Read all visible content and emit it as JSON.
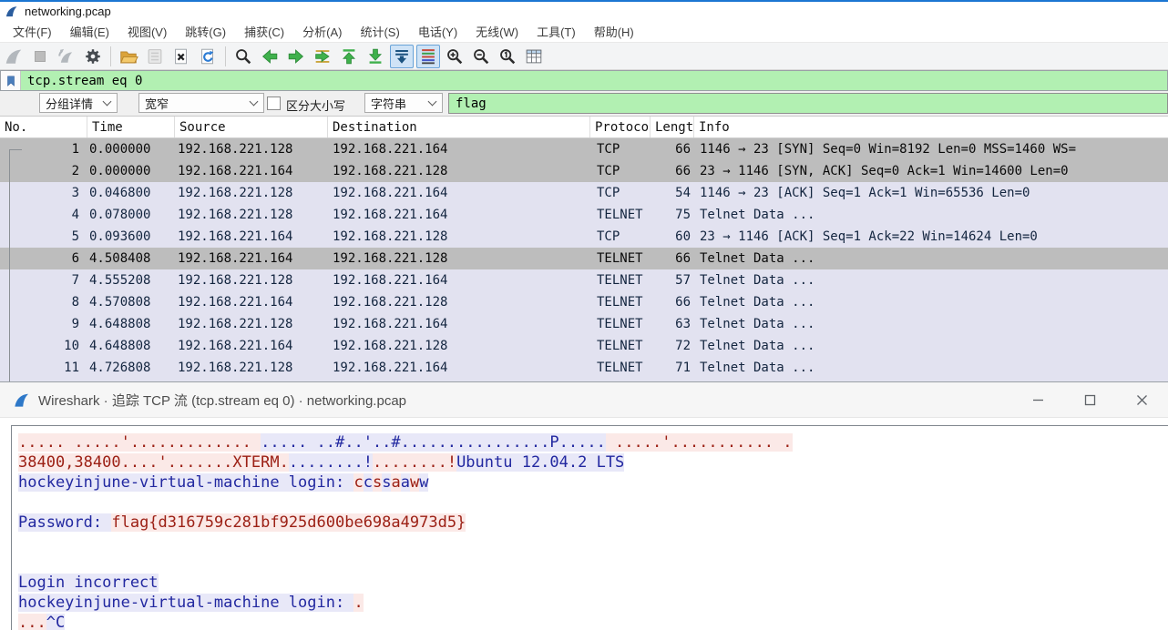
{
  "window": {
    "title": "networking.pcap",
    "menu": [
      "文件(F)",
      "编辑(E)",
      "视图(V)",
      "跳转(G)",
      "捕获(C)",
      "分析(A)",
      "统计(S)",
      "电话(Y)",
      "无线(W)",
      "工具(T)",
      "帮助(H)"
    ]
  },
  "toolbar": {
    "buttons": [
      {
        "name": "start-capture-icon",
        "state": "disabled"
      },
      {
        "name": "stop-capture-icon",
        "state": "disabled"
      },
      {
        "name": "restart-capture-icon",
        "state": "disabled"
      },
      {
        "name": "capture-options-icon",
        "state": "normal"
      },
      {
        "name": "separator"
      },
      {
        "name": "open-file-icon",
        "state": "normal"
      },
      {
        "name": "save-file-icon",
        "state": "disabled"
      },
      {
        "name": "close-file-icon",
        "state": "normal"
      },
      {
        "name": "reload-file-icon",
        "state": "normal"
      },
      {
        "name": "separator"
      },
      {
        "name": "find-packet-icon",
        "state": "normal"
      },
      {
        "name": "go-back-icon",
        "state": "normal"
      },
      {
        "name": "go-forward-icon",
        "state": "normal"
      },
      {
        "name": "go-to-packet-icon",
        "state": "normal"
      },
      {
        "name": "go-first-packet-icon",
        "state": "normal"
      },
      {
        "name": "go-last-packet-icon",
        "state": "normal"
      },
      {
        "name": "auto-scroll-icon",
        "state": "toggled"
      },
      {
        "name": "colorize-packets-icon",
        "state": "toggled"
      },
      {
        "name": "zoom-in-icon",
        "state": "normal"
      },
      {
        "name": "zoom-out-icon",
        "state": "normal"
      },
      {
        "name": "zoom-original-icon",
        "state": "normal"
      },
      {
        "name": "resize-columns-icon",
        "state": "normal"
      }
    ]
  },
  "filter_bar": {
    "value": "tcp.stream eq 0"
  },
  "find_bar": {
    "search_in_value": "分组详情",
    "char_width_value": "宽窄",
    "case_sensitive_label": "区分大小写",
    "case_sensitive_checked": false,
    "search_type_value": "字符串",
    "query_value": "flag"
  },
  "packet_list": {
    "columns": [
      "No.",
      "Time",
      "Source",
      "Destination",
      "Protocol",
      "Length",
      "Info"
    ],
    "rows": [
      {
        "no": "1",
        "time": "0.000000",
        "source": "192.168.221.128",
        "destination": "192.168.221.164",
        "protocol": "TCP",
        "length": "66",
        "info": "1146 → 23 [SYN] Seq=0 Win=8192 Len=0 MSS=1460 WS=",
        "selected": true
      },
      {
        "no": "2",
        "time": "0.000000",
        "source": "192.168.221.164",
        "destination": "192.168.221.128",
        "protocol": "TCP",
        "length": "66",
        "info": "23 → 1146 [SYN, ACK] Seq=0 Ack=1 Win=14600 Len=0",
        "selected": true
      },
      {
        "no": "3",
        "time": "0.046800",
        "source": "192.168.221.128",
        "destination": "192.168.221.164",
        "protocol": "TCP",
        "length": "54",
        "info": "1146 → 23 [ACK] Seq=1 Ack=1 Win=65536 Len=0",
        "selected": false
      },
      {
        "no": "4",
        "time": "0.078000",
        "source": "192.168.221.128",
        "destination": "192.168.221.164",
        "protocol": "TELNET",
        "length": "75",
        "info": "Telnet Data ...",
        "selected": false
      },
      {
        "no": "5",
        "time": "0.093600",
        "source": "192.168.221.164",
        "destination": "192.168.221.128",
        "protocol": "TCP",
        "length": "60",
        "info": "23 → 1146 [ACK] Seq=1 Ack=22 Win=14624 Len=0",
        "selected": false
      },
      {
        "no": "6",
        "time": "4.508408",
        "source": "192.168.221.164",
        "destination": "192.168.221.128",
        "protocol": "TELNET",
        "length": "66",
        "info": "Telnet Data ...",
        "selected": true
      },
      {
        "no": "7",
        "time": "4.555208",
        "source": "192.168.221.128",
        "destination": "192.168.221.164",
        "protocol": "TELNET",
        "length": "57",
        "info": "Telnet Data ...",
        "selected": false
      },
      {
        "no": "8",
        "time": "4.570808",
        "source": "192.168.221.164",
        "destination": "192.168.221.128",
        "protocol": "TELNET",
        "length": "66",
        "info": "Telnet Data ...",
        "selected": false
      },
      {
        "no": "9",
        "time": "4.648808",
        "source": "192.168.221.128",
        "destination": "192.168.221.164",
        "protocol": "TELNET",
        "length": "63",
        "info": "Telnet Data ...",
        "selected": false
      },
      {
        "no": "10",
        "time": "4.648808",
        "source": "192.168.221.164",
        "destination": "192.168.221.128",
        "protocol": "TELNET",
        "length": "72",
        "info": "Telnet Data ...",
        "selected": false
      },
      {
        "no": "11",
        "time": "4.726808",
        "source": "192.168.221.128",
        "destination": "192.168.221.164",
        "protocol": "TELNET",
        "length": "71",
        "info": "Telnet Data ...",
        "selected": false
      }
    ]
  },
  "dialog": {
    "title": "Wireshark · 追踪 TCP 流 (tcp.stream eq 0) · networking.pcap",
    "window_controls": [
      "minimize",
      "maximize",
      "close"
    ],
    "stream_lines": [
      [
        {
          "peer": "client",
          "text": "..... .....'............. "
        },
        {
          "peer": "server",
          "text": "..... ..#..'..#................P....."
        },
        {
          "peer": "client",
          "text": " .....'........... ."
        }
      ],
      [
        {
          "peer": "client",
          "text": "38400,38400....'.......XTERM."
        },
        {
          "peer": "server",
          "text": "........!"
        },
        {
          "peer": "client",
          "text": "........!"
        },
        {
          "peer": "server",
          "text": "Ubuntu 12.04.2 LTS"
        }
      ],
      [
        {
          "peer": "server",
          "text": "hockeyinjune-virtual-machine login: "
        },
        {
          "peer": "client",
          "text": "c"
        },
        {
          "peer": "server",
          "text": "c"
        },
        {
          "peer": "client",
          "text": "s"
        },
        {
          "peer": "server",
          "text": "s"
        },
        {
          "peer": "client",
          "text": "a"
        },
        {
          "peer": "server",
          "text": "a"
        },
        {
          "peer": "client",
          "text": "w"
        },
        {
          "peer": "server",
          "text": "w"
        }
      ],
      [],
      [
        {
          "peer": "server",
          "text": "Password: "
        },
        {
          "peer": "client",
          "text": "flag{d316759c281bf925d600be698a4973d5}"
        }
      ],
      [],
      [],
      [
        {
          "peer": "server",
          "text": "Login incorrect"
        }
      ],
      [
        {
          "peer": "server",
          "text": "hockeyinjune-virtual-machine login: "
        },
        {
          "peer": "client",
          "text": "."
        }
      ],
      [
        {
          "peer": "client",
          "text": "..."
        },
        {
          "peer": "server",
          "text": "^C"
        }
      ]
    ]
  },
  "colors": {
    "accent_top": "#1b76d2",
    "filter_valid_bg": "#b2f0b2",
    "row_default_bg": "#e2e2f0",
    "row_selected_bg": "#bdbdbd",
    "client_text": "#9c2015",
    "client_bg": "#fbe9e7",
    "server_text": "#2228a0",
    "server_bg": "#e8e8f8",
    "toggled_btn_bg": "#cfe3f6",
    "toggled_btn_border": "#69a3d8"
  }
}
